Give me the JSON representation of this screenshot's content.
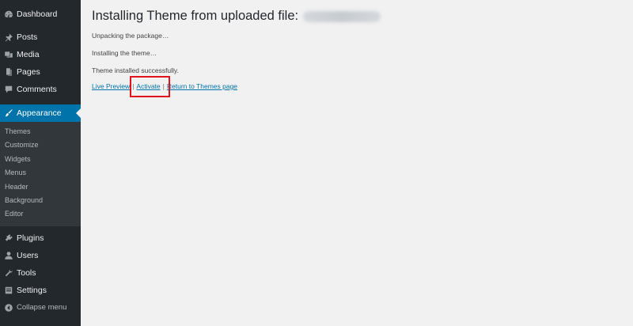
{
  "sidebar": {
    "items_top": [
      {
        "label": "Dashboard",
        "icon": "dashboard-icon"
      },
      {
        "label": "Posts",
        "icon": "pushpin-icon"
      },
      {
        "label": "Media",
        "icon": "media-icon"
      },
      {
        "label": "Pages",
        "icon": "pages-icon"
      },
      {
        "label": "Comments",
        "icon": "comment-icon"
      }
    ],
    "active": {
      "label": "Appearance",
      "icon": "paintbrush-icon"
    },
    "submenu": [
      "Themes",
      "Customize",
      "Widgets",
      "Menus",
      "Header",
      "Background",
      "Editor"
    ],
    "items_bottom": [
      {
        "label": "Plugins",
        "icon": "plugin-icon"
      },
      {
        "label": "Users",
        "icon": "user-icon"
      },
      {
        "label": "Tools",
        "icon": "wrench-icon"
      },
      {
        "label": "Settings",
        "icon": "settings-icon"
      }
    ],
    "collapse_label": "Collapse menu"
  },
  "main": {
    "title": "Installing Theme from uploaded file:",
    "messages": [
      "Unpacking the package…",
      "Installing the theme…",
      "Theme installed successfully."
    ],
    "links": {
      "live_preview": "Live Preview",
      "activate": "Activate",
      "return": "Return to Themes page",
      "separator": "|"
    }
  },
  "colors": {
    "sidebar_bg": "#23282d",
    "accent": "#0073aa",
    "highlight": "#e0121b",
    "page_bg": "#f1f1f1"
  }
}
